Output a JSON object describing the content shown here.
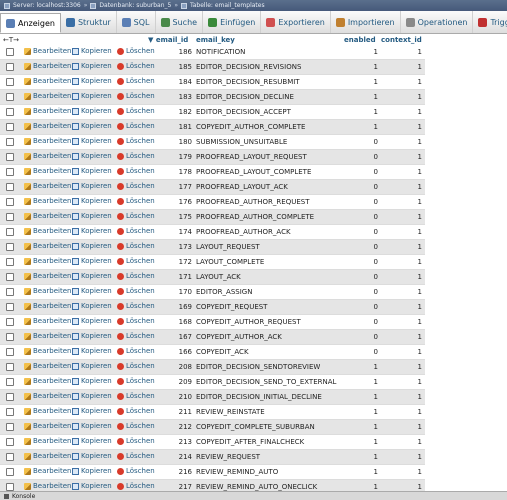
{
  "breadcrumb": {
    "server": "Server: localhost:3306",
    "database": "Datenbank: suburban_5",
    "table": "Tabelle: email_templates"
  },
  "tabs": [
    {
      "label": "Anzeigen",
      "icon": "table-browse-icon",
      "color": "#5b7fb5"
    },
    {
      "label": "Struktur",
      "icon": "structure-icon",
      "color": "#3a6ea5"
    },
    {
      "label": "SQL",
      "icon": "sql-icon",
      "color": "#5b7fb5"
    },
    {
      "label": "Suche",
      "icon": "search-icon",
      "color": "#4a8a4a"
    },
    {
      "label": "Einfügen",
      "icon": "insert-icon",
      "color": "#3a8a3a"
    },
    {
      "label": "Exportieren",
      "icon": "export-icon",
      "color": "#d05050"
    },
    {
      "label": "Importieren",
      "icon": "import-icon",
      "color": "#c08030"
    },
    {
      "label": "Operationen",
      "icon": "wrench-icon",
      "color": "#8a8a8a"
    },
    {
      "label": "Trigger",
      "icon": "trigger-icon",
      "color": "#c03030"
    }
  ],
  "toolbar": {
    "sort_arrows": "←T→"
  },
  "columns": {
    "id": "email_id",
    "key": "email_key",
    "enabled": "enabled",
    "context": "context_id"
  },
  "actions": {
    "edit": "Bearbeiten",
    "copy": "Kopieren",
    "delete": "Löschen"
  },
  "rows": [
    {
      "id": "186",
      "key": "NOTIFICATION",
      "enabled": "1",
      "ctx": "1"
    },
    {
      "id": "185",
      "key": "EDITOR_DECISION_REVISIONS",
      "enabled": "1",
      "ctx": "1"
    },
    {
      "id": "184",
      "key": "EDITOR_DECISION_RESUBMIT",
      "enabled": "1",
      "ctx": "1"
    },
    {
      "id": "183",
      "key": "EDITOR_DECISION_DECLINE",
      "enabled": "1",
      "ctx": "1"
    },
    {
      "id": "182",
      "key": "EDITOR_DECISION_ACCEPT",
      "enabled": "1",
      "ctx": "1"
    },
    {
      "id": "181",
      "key": "COPYEDIT_AUTHOR_COMPLETE",
      "enabled": "1",
      "ctx": "1"
    },
    {
      "id": "180",
      "key": "SUBMISSION_UNSUITABLE",
      "enabled": "0",
      "ctx": "1"
    },
    {
      "id": "179",
      "key": "PROOFREAD_LAYOUT_REQUEST",
      "enabled": "0",
      "ctx": "1"
    },
    {
      "id": "178",
      "key": "PROOFREAD_LAYOUT_COMPLETE",
      "enabled": "0",
      "ctx": "1"
    },
    {
      "id": "177",
      "key": "PROOFREAD_LAYOUT_ACK",
      "enabled": "0",
      "ctx": "1"
    },
    {
      "id": "176",
      "key": "PROOFREAD_AUTHOR_REQUEST",
      "enabled": "0",
      "ctx": "1"
    },
    {
      "id": "175",
      "key": "PROOFREAD_AUTHOR_COMPLETE",
      "enabled": "0",
      "ctx": "1"
    },
    {
      "id": "174",
      "key": "PROOFREAD_AUTHOR_ACK",
      "enabled": "0",
      "ctx": "1"
    },
    {
      "id": "173",
      "key": "LAYOUT_REQUEST",
      "enabled": "0",
      "ctx": "1"
    },
    {
      "id": "172",
      "key": "LAYOUT_COMPLETE",
      "enabled": "0",
      "ctx": "1"
    },
    {
      "id": "171",
      "key": "LAYOUT_ACK",
      "enabled": "0",
      "ctx": "1"
    },
    {
      "id": "170",
      "key": "EDITOR_ASSIGN",
      "enabled": "0",
      "ctx": "1"
    },
    {
      "id": "169",
      "key": "COPYEDIT_REQUEST",
      "enabled": "0",
      "ctx": "1"
    },
    {
      "id": "168",
      "key": "COPYEDIT_AUTHOR_REQUEST",
      "enabled": "0",
      "ctx": "1"
    },
    {
      "id": "167",
      "key": "COPYEDIT_AUTHOR_ACK",
      "enabled": "0",
      "ctx": "1"
    },
    {
      "id": "166",
      "key": "COPYEDIT_ACK",
      "enabled": "0",
      "ctx": "1"
    },
    {
      "id": "208",
      "key": "EDITOR_DECISION_SENDTOREVIEW",
      "enabled": "1",
      "ctx": "1"
    },
    {
      "id": "209",
      "key": "EDITOR_DECISION_SEND_TO_EXTERNAL",
      "enabled": "1",
      "ctx": "1"
    },
    {
      "id": "210",
      "key": "EDITOR_DECISION_INITIAL_DECLINE",
      "enabled": "1",
      "ctx": "1"
    },
    {
      "id": "211",
      "key": "REVIEW_REINSTATE",
      "enabled": "1",
      "ctx": "1"
    },
    {
      "id": "212",
      "key": "COPYEDIT_COMPLETE_SUBURBAN",
      "enabled": "1",
      "ctx": "1"
    },
    {
      "id": "213",
      "key": "COPYEDIT_AFTER_FINALCHECK",
      "enabled": "1",
      "ctx": "1"
    },
    {
      "id": "214",
      "key": "REVIEW_REQUEST",
      "enabled": "1",
      "ctx": "1"
    },
    {
      "id": "216",
      "key": "REVIEW_REMIND_AUTO",
      "enabled": "1",
      "ctx": "1"
    },
    {
      "id": "217",
      "key": "REVIEW_REMIND_AUTO_ONECLICK",
      "enabled": "1",
      "ctx": "1"
    }
  ],
  "console": {
    "label": "Konsole"
  }
}
